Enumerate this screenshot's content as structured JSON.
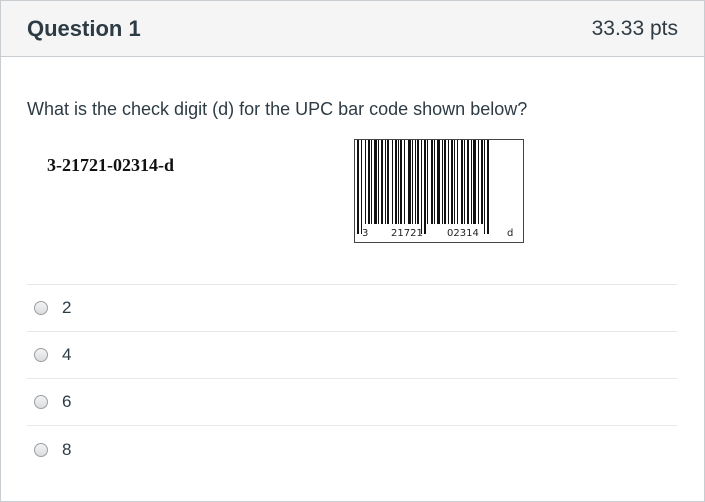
{
  "question": {
    "title": "Question 1",
    "points": "33.33 pts",
    "text": "What is the check digit (d) for the UPC bar code shown below?",
    "upc_code": "3-21721-02314-d"
  },
  "barcode": {
    "left_digit": "3",
    "group1": "21721",
    "group2": "02314",
    "check_digit": "d"
  },
  "answers": [
    {
      "label": "2"
    },
    {
      "label": "4"
    },
    {
      "label": "6"
    },
    {
      "label": "8"
    }
  ],
  "colors": {
    "header_bg": "#f5f5f5",
    "border": "#c7cdd1",
    "text": "#2d3b45"
  }
}
